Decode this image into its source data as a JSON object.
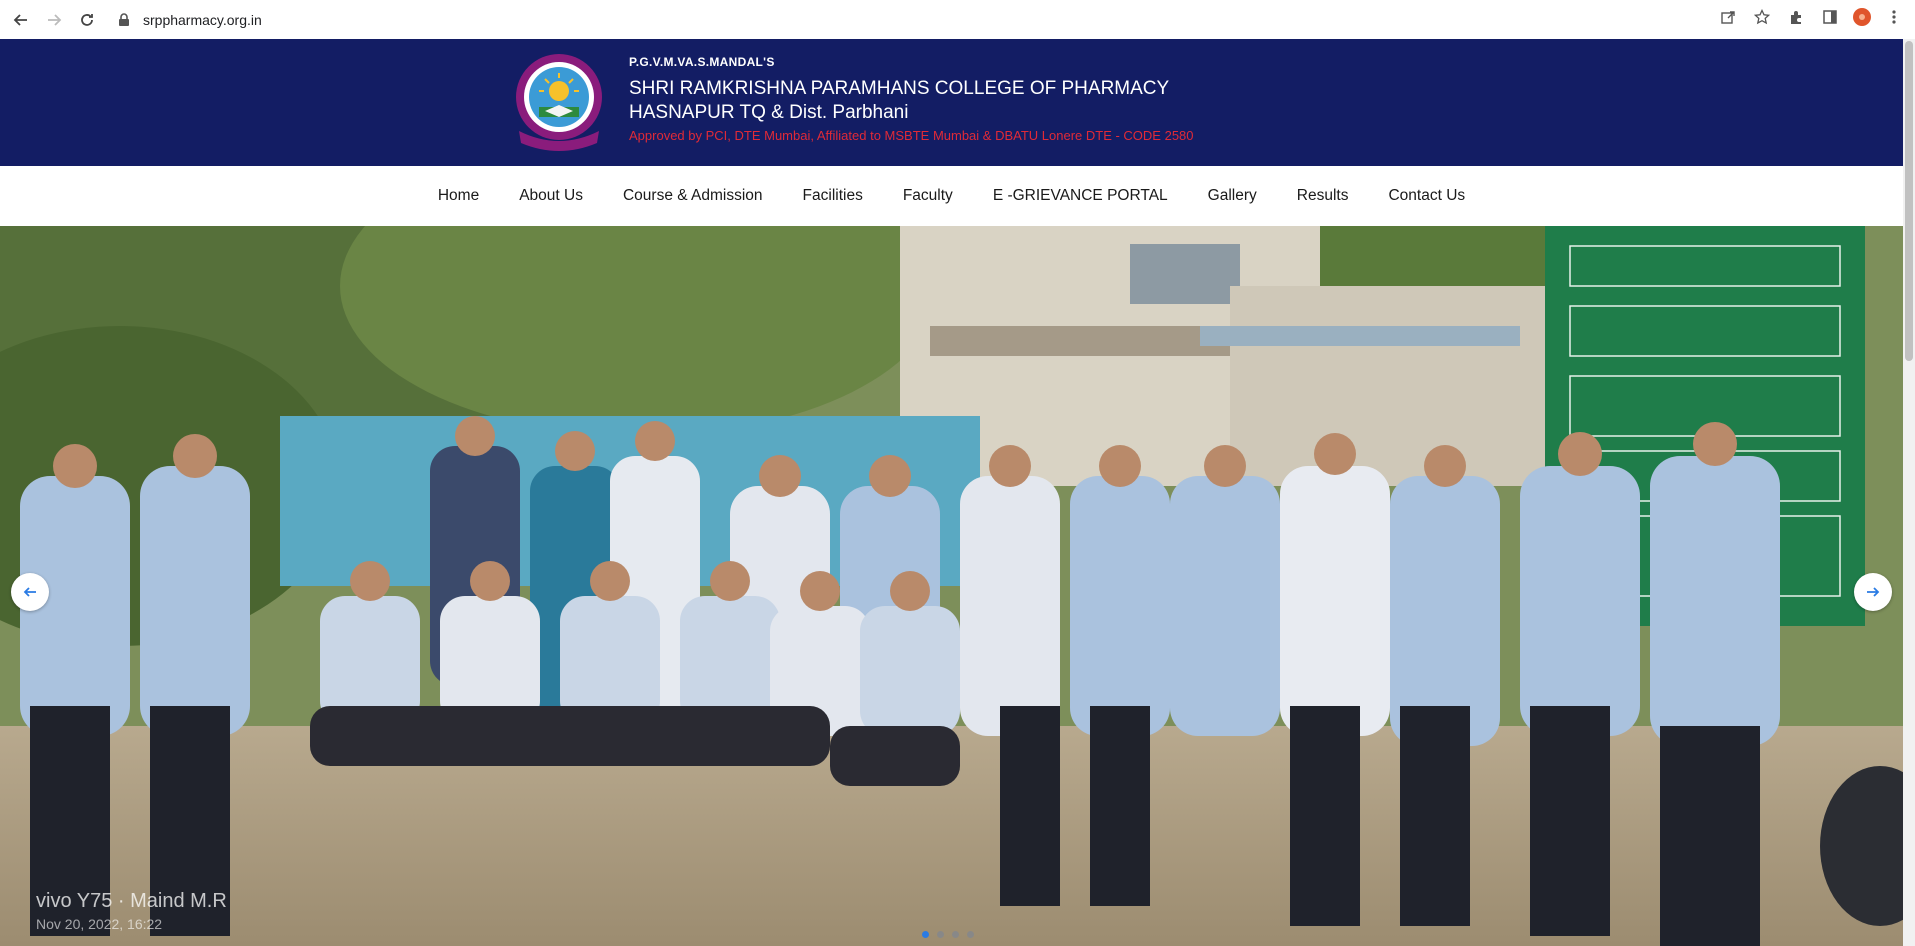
{
  "browser": {
    "url": "srppharmacy.org.in",
    "icons": [
      "back-icon",
      "forward-icon",
      "reload-icon",
      "lock-icon",
      "share-icon",
      "star-icon",
      "extensions-icon",
      "sidebar-icon",
      "profile-icon",
      "menu-dots-icon"
    ]
  },
  "header": {
    "mandal": "P.G.V.M.VA.S.MANDAL'S",
    "college_line1": "SHRI RAMKRISHNA PARAMHANS COLLEGE OF PHARMACY",
    "college_line2": "HASNAPUR TQ & Dist. Parbhani",
    "approved": "Approved by PCI, DTE Mumbai, Affiliated to MSBTE Mumbai & DBATU Lonere DTE - CODE 2580",
    "background": "#131d64",
    "accent": "#e02a37"
  },
  "menu": {
    "items": [
      "Home",
      "About Us",
      "Course & Admission",
      "Facilities",
      "Faculty",
      "E -GRIEVANCE PORTAL",
      "Gallery",
      "Results",
      "Contact Us"
    ]
  },
  "slider": {
    "watermark_line1": "vivo Y75 · Maind M.R",
    "watermark_line2": "Nov 20, 2022, 16:22",
    "slide_count": 4,
    "active_slide": 1,
    "active_dot_color": "#2a7be4"
  }
}
